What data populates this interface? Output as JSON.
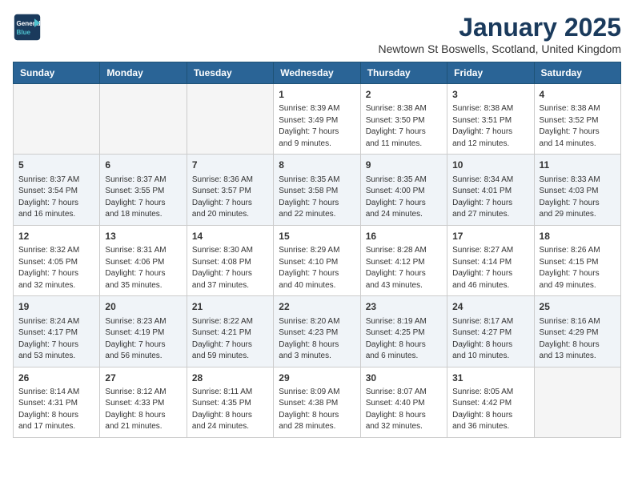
{
  "logo": {
    "line1": "General",
    "line2": "Blue"
  },
  "title": "January 2025",
  "subtitle": "Newtown St Boswells, Scotland, United Kingdom",
  "days_of_week": [
    "Sunday",
    "Monday",
    "Tuesday",
    "Wednesday",
    "Thursday",
    "Friday",
    "Saturday"
  ],
  "weeks": [
    [
      {
        "day": "",
        "info": ""
      },
      {
        "day": "",
        "info": ""
      },
      {
        "day": "",
        "info": ""
      },
      {
        "day": "1",
        "info": "Sunrise: 8:39 AM\nSunset: 3:49 PM\nDaylight: 7 hours\nand 9 minutes."
      },
      {
        "day": "2",
        "info": "Sunrise: 8:38 AM\nSunset: 3:50 PM\nDaylight: 7 hours\nand 11 minutes."
      },
      {
        "day": "3",
        "info": "Sunrise: 8:38 AM\nSunset: 3:51 PM\nDaylight: 7 hours\nand 12 minutes."
      },
      {
        "day": "4",
        "info": "Sunrise: 8:38 AM\nSunset: 3:52 PM\nDaylight: 7 hours\nand 14 minutes."
      }
    ],
    [
      {
        "day": "5",
        "info": "Sunrise: 8:37 AM\nSunset: 3:54 PM\nDaylight: 7 hours\nand 16 minutes."
      },
      {
        "day": "6",
        "info": "Sunrise: 8:37 AM\nSunset: 3:55 PM\nDaylight: 7 hours\nand 18 minutes."
      },
      {
        "day": "7",
        "info": "Sunrise: 8:36 AM\nSunset: 3:57 PM\nDaylight: 7 hours\nand 20 minutes."
      },
      {
        "day": "8",
        "info": "Sunrise: 8:35 AM\nSunset: 3:58 PM\nDaylight: 7 hours\nand 22 minutes."
      },
      {
        "day": "9",
        "info": "Sunrise: 8:35 AM\nSunset: 4:00 PM\nDaylight: 7 hours\nand 24 minutes."
      },
      {
        "day": "10",
        "info": "Sunrise: 8:34 AM\nSunset: 4:01 PM\nDaylight: 7 hours\nand 27 minutes."
      },
      {
        "day": "11",
        "info": "Sunrise: 8:33 AM\nSunset: 4:03 PM\nDaylight: 7 hours\nand 29 minutes."
      }
    ],
    [
      {
        "day": "12",
        "info": "Sunrise: 8:32 AM\nSunset: 4:05 PM\nDaylight: 7 hours\nand 32 minutes."
      },
      {
        "day": "13",
        "info": "Sunrise: 8:31 AM\nSunset: 4:06 PM\nDaylight: 7 hours\nand 35 minutes."
      },
      {
        "day": "14",
        "info": "Sunrise: 8:30 AM\nSunset: 4:08 PM\nDaylight: 7 hours\nand 37 minutes."
      },
      {
        "day": "15",
        "info": "Sunrise: 8:29 AM\nSunset: 4:10 PM\nDaylight: 7 hours\nand 40 minutes."
      },
      {
        "day": "16",
        "info": "Sunrise: 8:28 AM\nSunset: 4:12 PM\nDaylight: 7 hours\nand 43 minutes."
      },
      {
        "day": "17",
        "info": "Sunrise: 8:27 AM\nSunset: 4:14 PM\nDaylight: 7 hours\nand 46 minutes."
      },
      {
        "day": "18",
        "info": "Sunrise: 8:26 AM\nSunset: 4:15 PM\nDaylight: 7 hours\nand 49 minutes."
      }
    ],
    [
      {
        "day": "19",
        "info": "Sunrise: 8:24 AM\nSunset: 4:17 PM\nDaylight: 7 hours\nand 53 minutes."
      },
      {
        "day": "20",
        "info": "Sunrise: 8:23 AM\nSunset: 4:19 PM\nDaylight: 7 hours\nand 56 minutes."
      },
      {
        "day": "21",
        "info": "Sunrise: 8:22 AM\nSunset: 4:21 PM\nDaylight: 7 hours\nand 59 minutes."
      },
      {
        "day": "22",
        "info": "Sunrise: 8:20 AM\nSunset: 4:23 PM\nDaylight: 8 hours\nand 3 minutes."
      },
      {
        "day": "23",
        "info": "Sunrise: 8:19 AM\nSunset: 4:25 PM\nDaylight: 8 hours\nand 6 minutes."
      },
      {
        "day": "24",
        "info": "Sunrise: 8:17 AM\nSunset: 4:27 PM\nDaylight: 8 hours\nand 10 minutes."
      },
      {
        "day": "25",
        "info": "Sunrise: 8:16 AM\nSunset: 4:29 PM\nDaylight: 8 hours\nand 13 minutes."
      }
    ],
    [
      {
        "day": "26",
        "info": "Sunrise: 8:14 AM\nSunset: 4:31 PM\nDaylight: 8 hours\nand 17 minutes."
      },
      {
        "day": "27",
        "info": "Sunrise: 8:12 AM\nSunset: 4:33 PM\nDaylight: 8 hours\nand 21 minutes."
      },
      {
        "day": "28",
        "info": "Sunrise: 8:11 AM\nSunset: 4:35 PM\nDaylight: 8 hours\nand 24 minutes."
      },
      {
        "day": "29",
        "info": "Sunrise: 8:09 AM\nSunset: 4:38 PM\nDaylight: 8 hours\nand 28 minutes."
      },
      {
        "day": "30",
        "info": "Sunrise: 8:07 AM\nSunset: 4:40 PM\nDaylight: 8 hours\nand 32 minutes."
      },
      {
        "day": "31",
        "info": "Sunrise: 8:05 AM\nSunset: 4:42 PM\nDaylight: 8 hours\nand 36 minutes."
      },
      {
        "day": "",
        "info": ""
      }
    ]
  ]
}
